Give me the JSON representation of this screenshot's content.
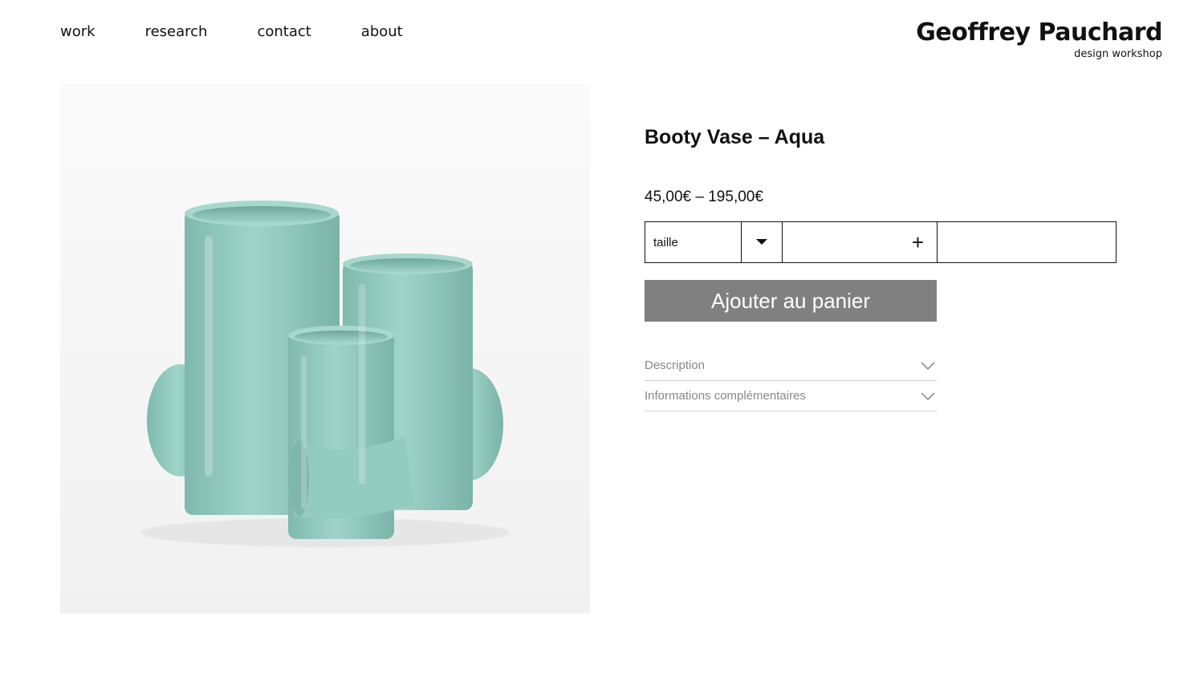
{
  "nav": {
    "items": [
      {
        "label": "work"
      },
      {
        "label": "research"
      },
      {
        "label": "contact"
      },
      {
        "label": "about"
      }
    ]
  },
  "brand": {
    "name": "Geoffrey Pauchard",
    "tagline": "design workshop"
  },
  "product": {
    "title": "Booty Vase – Aqua",
    "price": "45,00€ – 195,00€",
    "image_icon": "aqua-vase-photo"
  },
  "variation": {
    "select_label": "taille",
    "arrow_icon": "caret-down-icon",
    "qty_icon": "plus-icon",
    "plus_symbol": "+"
  },
  "cart": {
    "button_label": "Ajouter au panier",
    "button_color": "#808080"
  },
  "accordion": {
    "items": [
      {
        "label": "Description",
        "icon": "chevron-down-icon"
      },
      {
        "label": "Informations complémentaires",
        "icon": "chevron-down-icon"
      }
    ]
  },
  "colors": {
    "vase": "#8fc8bd",
    "text": "#111111",
    "muted": "#888888"
  }
}
